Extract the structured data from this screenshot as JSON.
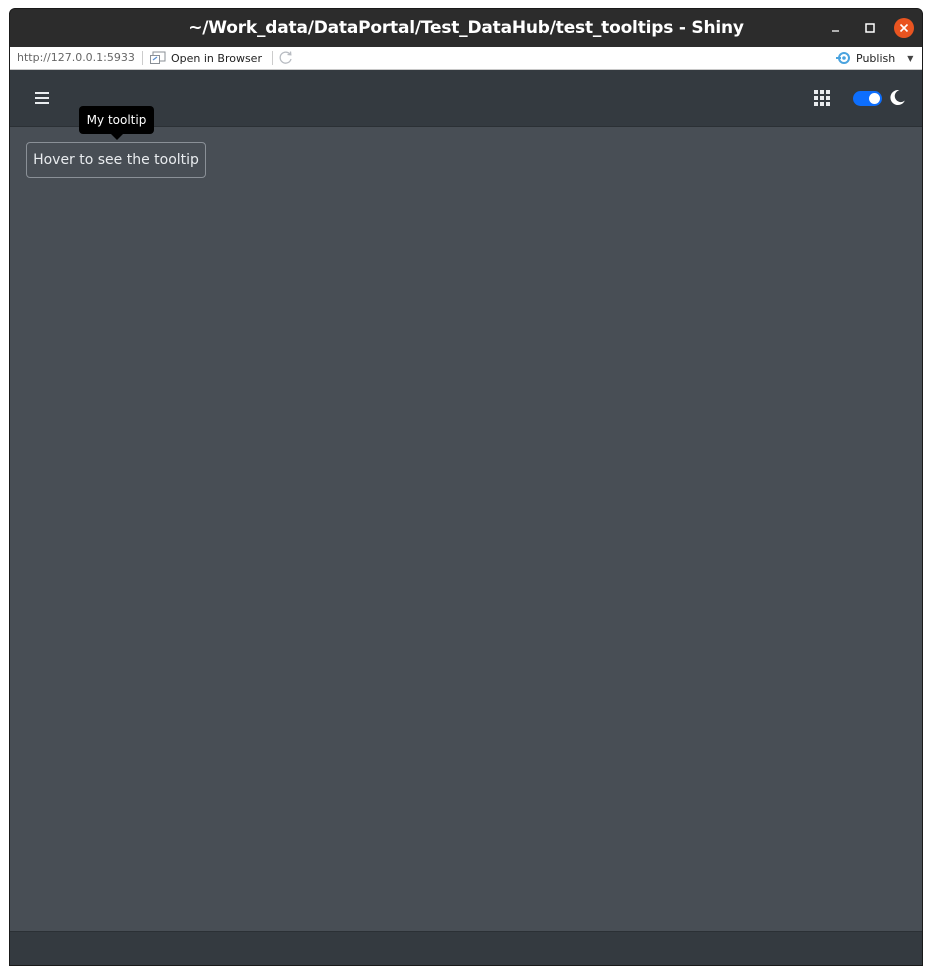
{
  "window": {
    "title": "~/Work_data/DataPortal/Test_DataHub/test_tooltips - Shiny",
    "controls": {
      "minimize_icon": "minimize-icon",
      "maximize_icon": "maximize-icon",
      "close_icon": "close-icon",
      "close_color": "#e95420"
    }
  },
  "addressbar": {
    "url": "http://127.0.0.1:5933",
    "open_in_browser": "Open in Browser",
    "publish": "Publish"
  },
  "navbar": {
    "menu_icon": "hamburger-menu-icon",
    "apps_icon": "grid-apps-icon",
    "theme_toggle_on": true,
    "theme_icon": "moon-icon",
    "toggle_color": "#0d6efd"
  },
  "main": {
    "button_label": "Hover to see the tooltip",
    "tooltip_text": "My tooltip"
  },
  "colors": {
    "navbar_bg": "#343a40",
    "body_bg": "#484e55",
    "tooltip_bg": "#000000"
  }
}
